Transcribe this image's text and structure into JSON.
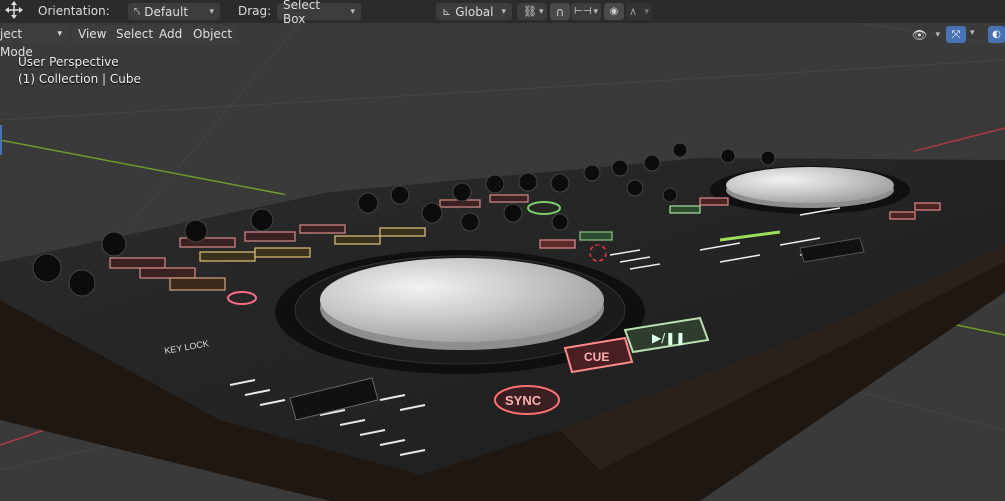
{
  "header": {
    "orientation_label": "Orientation:",
    "orientation_value": "Default",
    "drag_label": "Drag:",
    "drag_value": "Select Box",
    "transform_space": "Global"
  },
  "menubar": {
    "mode": "ject Mode",
    "items": [
      "View",
      "Select",
      "Add",
      "Object"
    ]
  },
  "viewport": {
    "perspective": "User Perspective",
    "collection": "(1) Collection | Cube"
  },
  "model_text": {
    "cue": "CUE",
    "sync": "SYNC",
    "key_lock": "KEY LOCK"
  },
  "colors": {
    "background": "#393939",
    "header": "#2b2b2b",
    "accent_blue": "#4772b3",
    "x_axis": "#b03a44",
    "y_axis": "#6e9a2d"
  },
  "icons": [
    "transform-gizmo-icon",
    "pivot-icon",
    "transform-orientation-icon",
    "snap-link-icon",
    "magnet-icon",
    "snap-target-icon",
    "proportional-edit-icon",
    "falloff-curve-icon",
    "visibility-eye-icon",
    "gizmo-toggle-icon",
    "overlay-toggle-icon"
  ]
}
